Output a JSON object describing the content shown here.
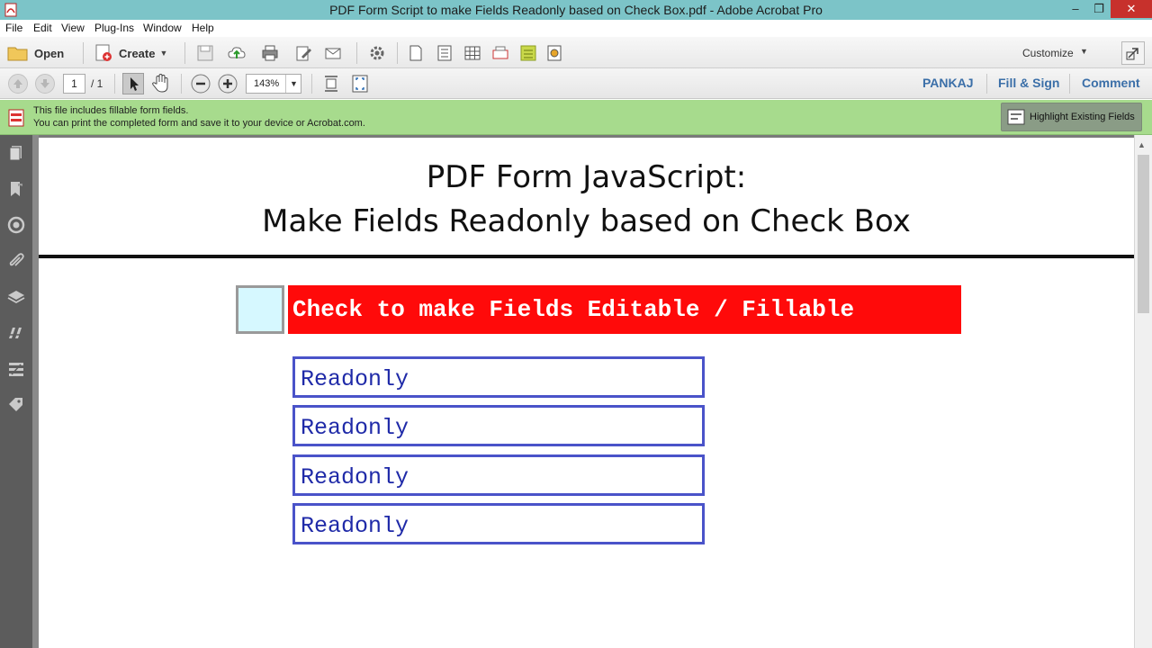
{
  "window": {
    "title": "PDF Form Script to make  Fields Readonly based on Check Box.pdf - Adobe Acrobat Pro",
    "controls": {
      "minimize": "–",
      "maximize": "❐",
      "close": "✕"
    }
  },
  "menu": {
    "items": [
      "File",
      "Edit",
      "View",
      "Plug-Ins",
      "Window",
      "Help"
    ]
  },
  "toolbar": {
    "open_label": "Open",
    "create_label": "Create",
    "create_caret": "▼",
    "customize_label": "Customize",
    "customize_caret": "▼"
  },
  "navbar": {
    "page_current": "1",
    "page_total": "/ 1",
    "zoom_value": "143%",
    "zoom_caret": "▼",
    "user_link": "PANKAJ",
    "fill_sign_link": "Fill & Sign",
    "comment_link": "Comment"
  },
  "notice": {
    "line1": "This file includes fillable form fields.",
    "line2": "You can print the completed form and save it to your device or Acrobat.com.",
    "highlight_button": "Highlight Existing Fields"
  },
  "document": {
    "title_line1": "PDF Form JavaScript:",
    "title_line2": "Make Fields Readonly based on Check Box",
    "checkbox_label": "Check to make Fields Editable / Fillable",
    "checkbox_checked": false,
    "fields": [
      {
        "value": "Readonly"
      },
      {
        "value": "Readonly"
      },
      {
        "value": "Readonly"
      },
      {
        "value": "Readonly"
      }
    ]
  },
  "colors": {
    "titlebar": "#7cc4c8",
    "notice_bar": "#a7db8d",
    "banner_red": "#ff0a0a",
    "field_border": "#4a53c9",
    "field_text": "#1f2aa8",
    "link_blue": "#3b6fa8"
  },
  "icons": {
    "left_panel": [
      "pages-icon",
      "bookmarks-icon",
      "signatures-icon",
      "attachments-icon",
      "layers-icon",
      "content-icon",
      "model-tree-icon",
      "tags-icon"
    ]
  }
}
